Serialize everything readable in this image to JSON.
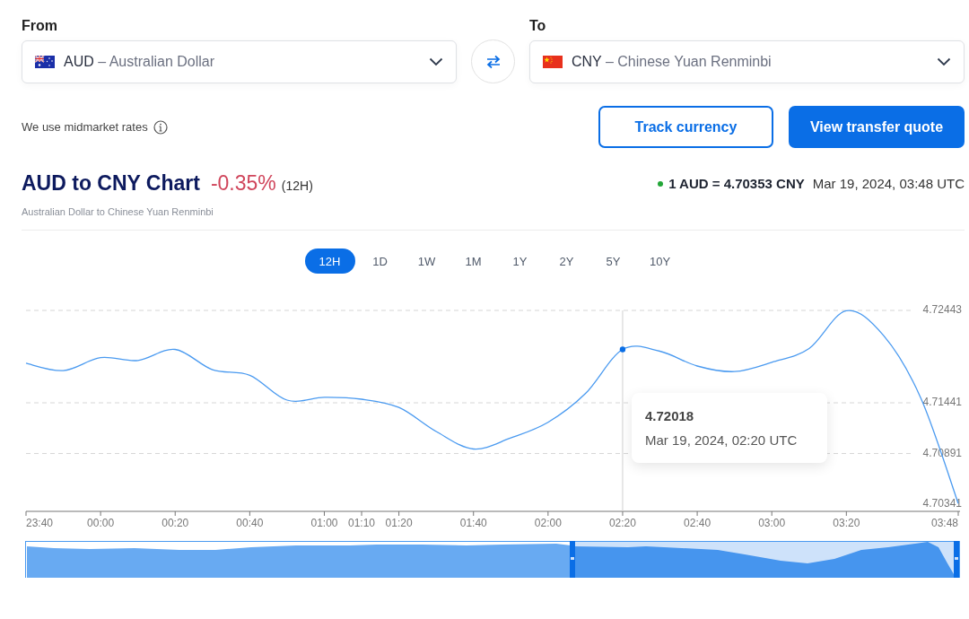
{
  "from": {
    "label": "From",
    "code": "AUD",
    "name": "– Australian Dollar"
  },
  "to": {
    "label": "To",
    "code": "CNY",
    "name": "– Chinese Yuan Renminbi"
  },
  "rates_note": "We use midmarket rates",
  "buttons": [
    {
      "label": "Track currency",
      "kind": "outline"
    },
    {
      "label": "View transfer quote",
      "kind": "primary"
    }
  ],
  "heading": {
    "title": "AUD to CNY Chart",
    "change": "-0.35%",
    "period": "(12H)",
    "subtitle": "Australian Dollar to Chinese Yuan Renminbi"
  },
  "rate": {
    "text": "1 AUD = 4.70353 CNY",
    "time": "Mar 19, 2024, 03:48 UTC"
  },
  "ranges": [
    {
      "label": "12H",
      "selected": true
    },
    {
      "label": "1D",
      "selected": false
    },
    {
      "label": "1W",
      "selected": false
    },
    {
      "label": "1M",
      "selected": false
    },
    {
      "label": "1Y",
      "selected": false
    },
    {
      "label": "2Y",
      "selected": false
    },
    {
      "label": "5Y",
      "selected": false
    },
    {
      "label": "10Y",
      "selected": false
    }
  ],
  "chart_data": {
    "type": "line",
    "categories": [
      "23:40",
      null,
      "00:00",
      null,
      "00:20",
      null,
      "00:40",
      null,
      "01:00",
      "01:10",
      "01:20",
      null,
      "01:40",
      null,
      "02:00",
      null,
      "02:20",
      null,
      "02:40",
      null,
      "03:00",
      null,
      "03:20",
      null,
      null,
      "03:48"
    ],
    "series": [
      {
        "color": "#4a9af0",
        "values": [
          4.7187,
          4.7179,
          4.7193,
          4.719,
          4.7202,
          4.718,
          4.7174,
          4.7147,
          4.715,
          4.7148,
          4.7139,
          4.7113,
          4.7094,
          4.7106,
          4.7123,
          4.7154,
          4.7202,
          4.72,
          4.7184,
          4.7178,
          4.7188,
          4.7203,
          4.7244,
          4.7217,
          4.7149,
          4.7035
        ]
      }
    ],
    "yticks": [
      4.70341,
      4.70891,
      4.71441,
      4.72443
    ],
    "ylim": [
      4.70264,
      4.72443
    ],
    "ref_lines": [
      {
        "axis": "x",
        "value": "02:20"
      }
    ]
  },
  "tooltip": {
    "value": "4.72018",
    "time": "Mar 19, 2024, 02:20 UTC"
  }
}
